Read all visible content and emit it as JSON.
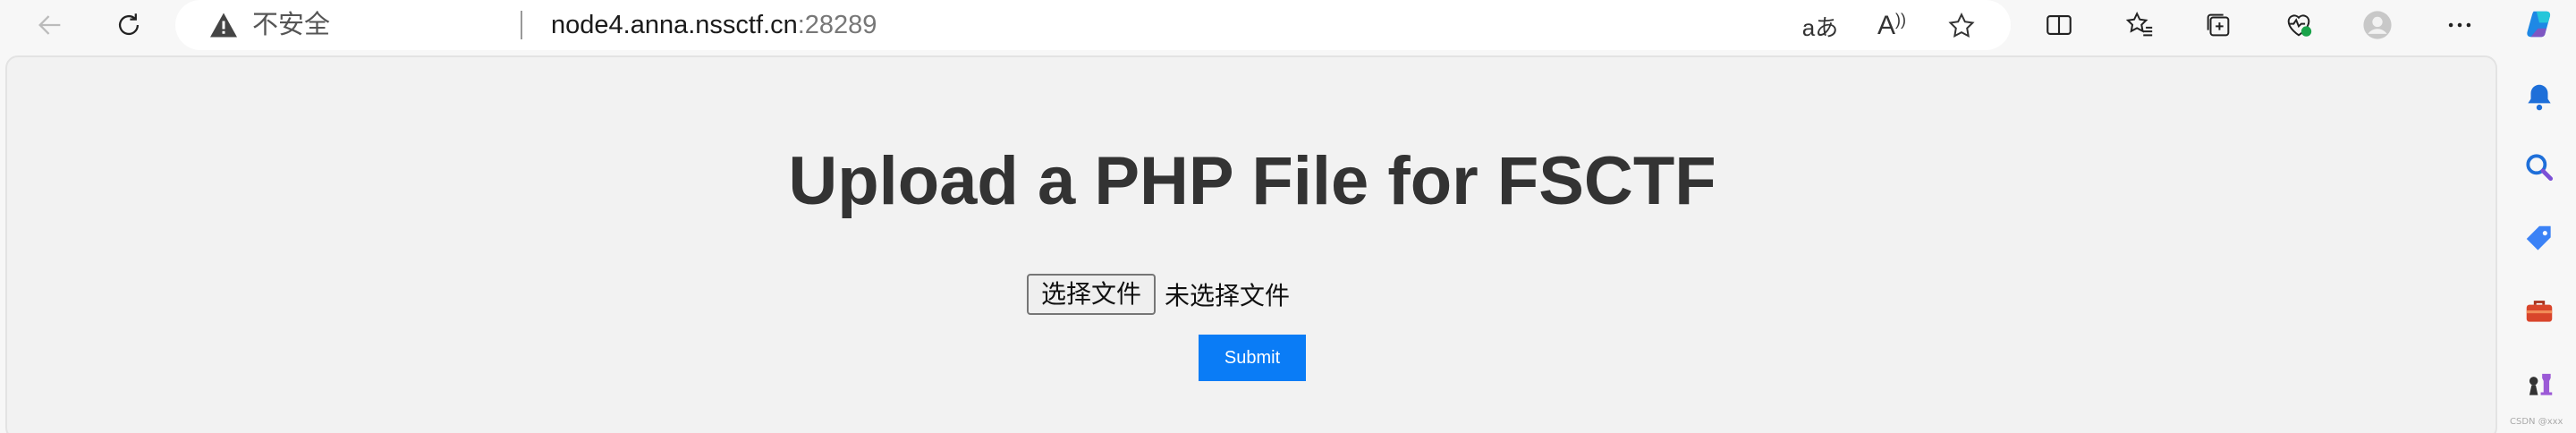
{
  "browser": {
    "security_label": "不安全",
    "url_host": "node4.anna.nssctf.cn",
    "url_port": ":28289",
    "read_aloud_label": "aあ",
    "font_label": "A"
  },
  "page": {
    "title": "Upload a PHP File for FSCTF",
    "file_button_label": "选择文件",
    "file_status": "未选择文件",
    "submit_label": "Submit"
  },
  "colors": {
    "submit_bg": "#0a7cf6",
    "page_bg": "#f2f2f2",
    "title_text": "#333333"
  },
  "sidebar": {
    "icons": [
      "bell-icon",
      "search-icon",
      "tag-icon",
      "toolbox-icon",
      "chess-icon"
    ]
  },
  "watermark": "CSDN @xxx"
}
